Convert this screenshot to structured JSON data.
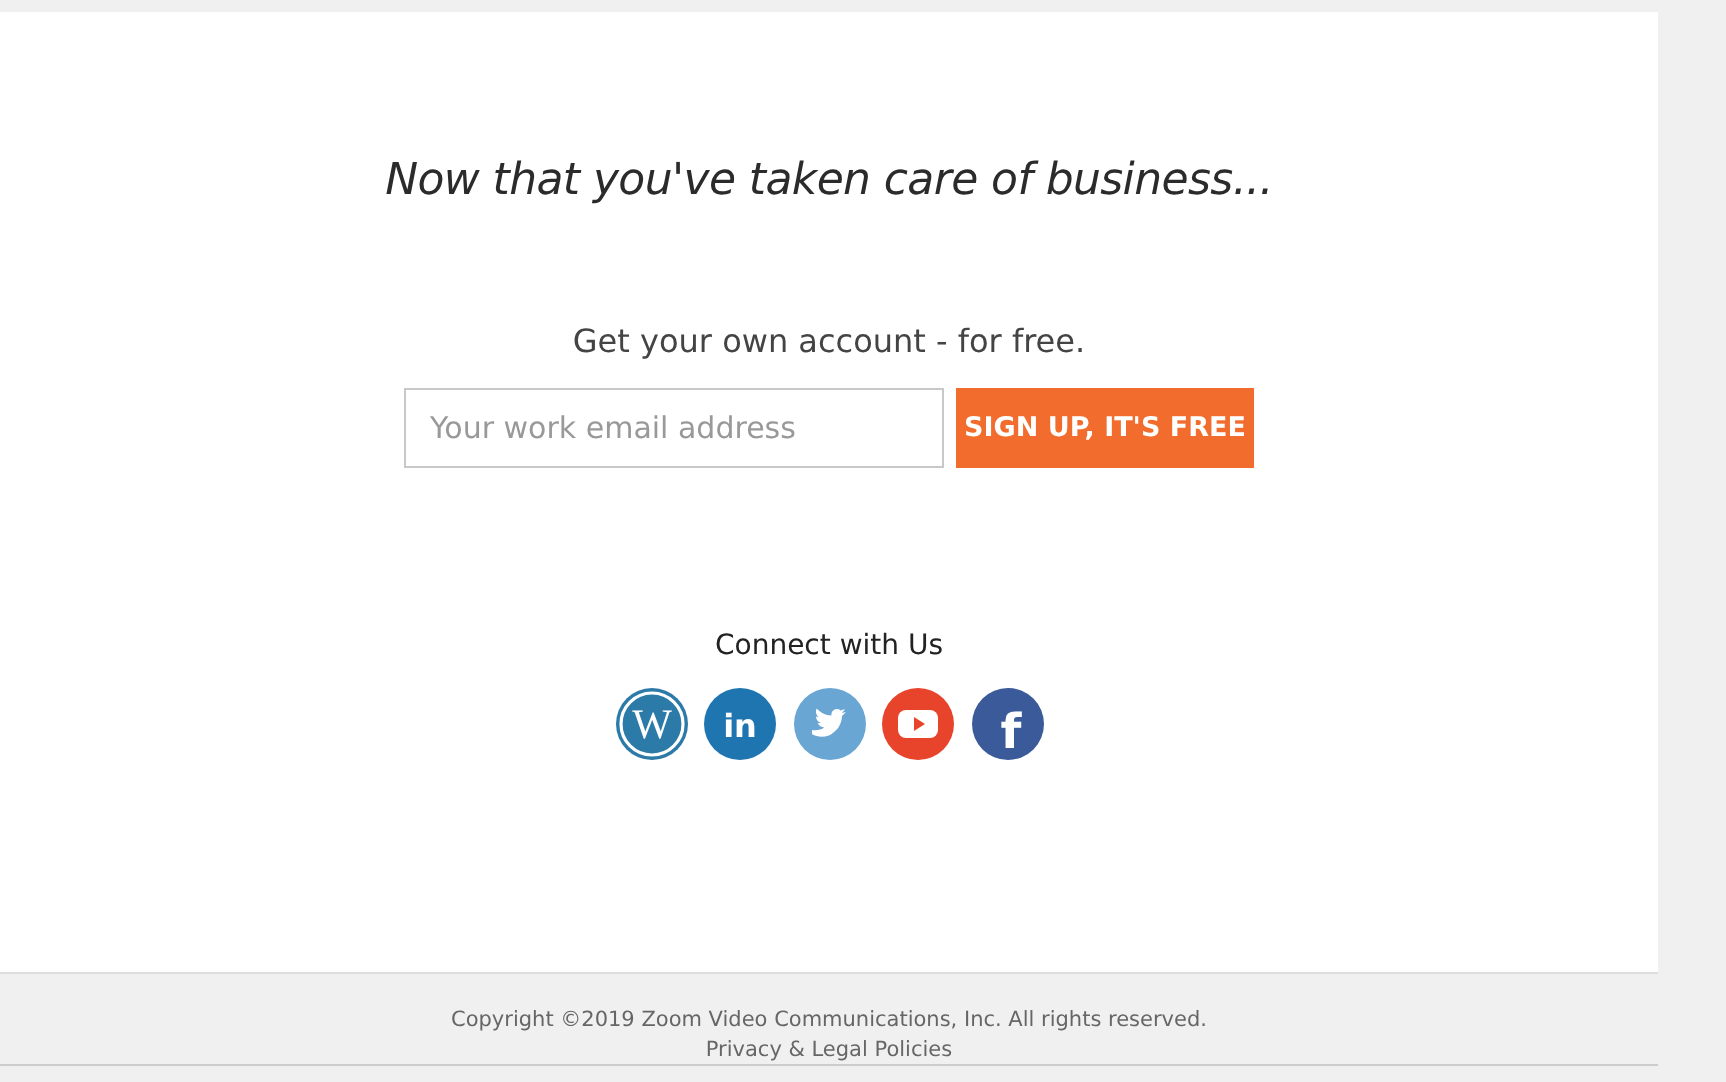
{
  "headline": "Now that you've taken care of business...",
  "signup": {
    "prompt": "Get your own account - for free.",
    "email_field": {
      "placeholder": "Your work email address"
    },
    "button": "SIGN UP, IT'S FREE"
  },
  "connect": {
    "title": "Connect with Us",
    "links": [
      {
        "kind": "wordpress",
        "glyph": "W"
      },
      {
        "kind": "linkedin",
        "glyph": "in"
      },
      {
        "kind": "twitter"
      },
      {
        "kind": "youtube"
      },
      {
        "kind": "facebook",
        "glyph": "f"
      }
    ]
  },
  "footer": {
    "copyright": "Copyright ©2019 Zoom Video Communications, Inc. All rights reserved.",
    "link": "Privacy & Legal Policies"
  }
}
